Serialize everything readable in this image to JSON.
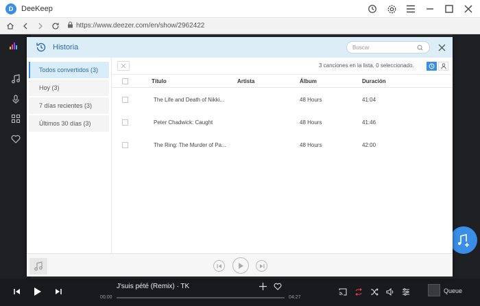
{
  "app": {
    "title": "DeeKeep",
    "logo_letter": "D"
  },
  "browser": {
    "url": "https://www.deezer.com/en/show/2962422"
  },
  "dialog": {
    "title": "Historia",
    "search_placeholder": "Buscar",
    "sidebar": [
      {
        "label": "Todos convertidos (3)",
        "active": true
      },
      {
        "label": "Hoy (3)",
        "active": false
      },
      {
        "label": "7 días recientes (3)",
        "active": false
      },
      {
        "label": "Últimos 30 días (3)",
        "active": false
      }
    ],
    "count_text": "3 canciones en la lista, 0 seleccionado.",
    "columns": {
      "title": "Título",
      "artist": "Artista",
      "album": "Álbum",
      "duration": "Duración"
    },
    "rows": [
      {
        "title": "The Life and Death of Nikki...",
        "artist": "",
        "album": "48 Hours",
        "duration": "41:04"
      },
      {
        "title": "Peter Chadwick: Caught",
        "artist": "",
        "album": "48 Hours",
        "duration": "41:46"
      },
      {
        "title": "The Ring: The Murder of Pa...",
        "artist": "",
        "album": "48 Hours",
        "duration": "42:00"
      }
    ]
  },
  "player": {
    "track": "J'suis pété (Remix) · TK",
    "elapsed": "00:00",
    "total": "04:27",
    "progress": 0,
    "queue_label": "Queue"
  },
  "colors": {
    "accent": "#3a8ee6",
    "dialog_header": "#dcedf8",
    "player_bg": "#191a1d"
  }
}
